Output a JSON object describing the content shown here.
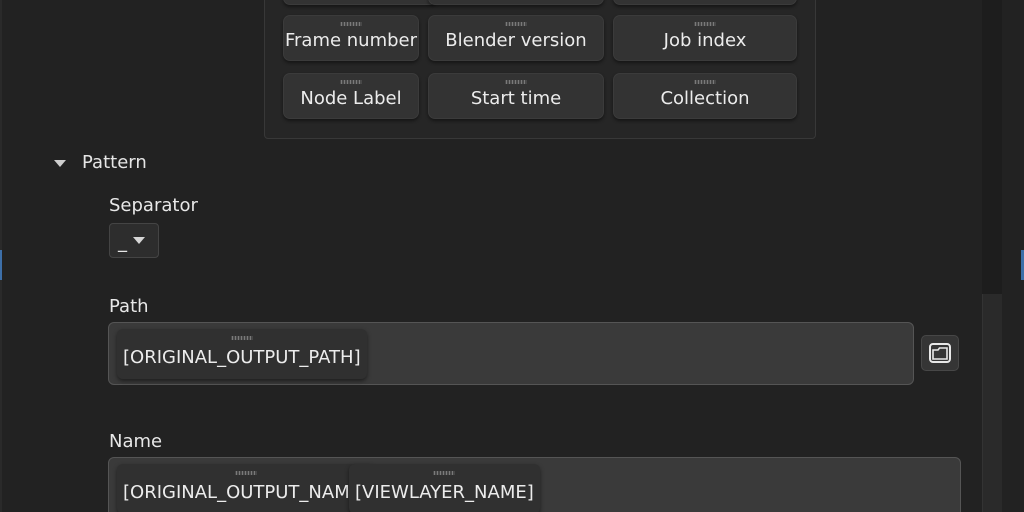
{
  "tokens": {
    "row1": [
      {
        "label": "Frame number"
      },
      {
        "label": "Blender version"
      },
      {
        "label": "Job index"
      }
    ],
    "row2": [
      {
        "label": "Node Label"
      },
      {
        "label": "Start time"
      },
      {
        "label": "Collection"
      }
    ]
  },
  "pattern": {
    "title": "Pattern",
    "separator": {
      "label": "Separator",
      "value": "_"
    },
    "path": {
      "label": "Path",
      "chips": [
        "[ORIGINAL_OUTPUT_PATH]"
      ]
    },
    "name": {
      "label": "Name",
      "chips": [
        "[ORIGINAL_OUTPUT_NAME]",
        "[VIEWLAYER_NAME]"
      ]
    }
  },
  "icons": {
    "folder": "folder-icon",
    "expand": "chevron-down-icon",
    "dropdown": "caret-down-icon"
  }
}
